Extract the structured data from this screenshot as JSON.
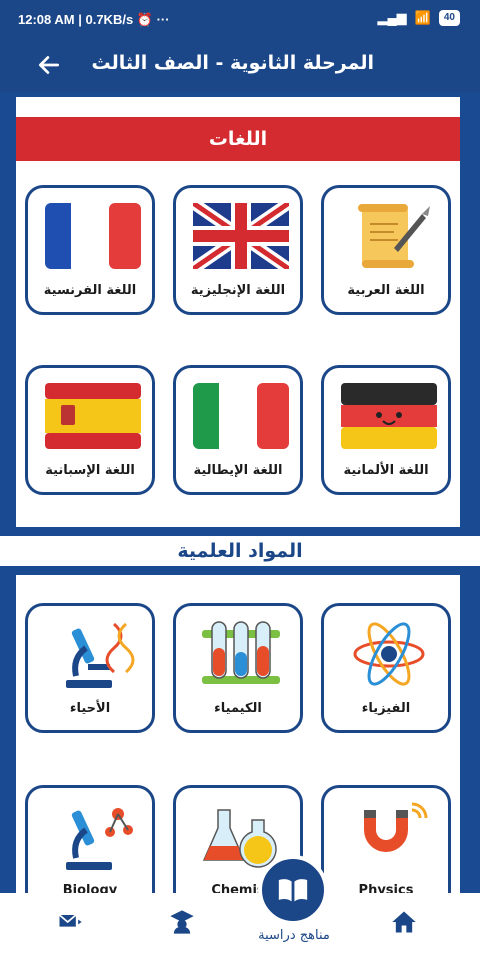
{
  "status_bar": {
    "time": "12:08 AM",
    "speed": "0.7KB/s",
    "battery": "40"
  },
  "header": {
    "title": "المرحلة الثانوية - الصف الثالث"
  },
  "languages": {
    "section_title": "اللغات",
    "tiles": [
      {
        "label": "اللغة العربية",
        "icon": "scroll-quill-icon"
      },
      {
        "label": "اللغة الإنجليزية",
        "icon": "uk-flag-icon"
      },
      {
        "label": "اللغة الفرنسية",
        "icon": "france-flag-icon"
      },
      {
        "label": "اللغة الألمانية",
        "icon": "germany-flag-icon"
      },
      {
        "label": "اللغة الإيطالية",
        "icon": "italy-flag-icon"
      },
      {
        "label": "اللغة الإسبانية",
        "icon": "spain-flag-icon"
      }
    ]
  },
  "sciences": {
    "section_title": "المواد العلمية",
    "tiles": [
      {
        "label": "الفيزياء",
        "icon": "atom-icon"
      },
      {
        "label": "الكيمياء",
        "icon": "test-tubes-icon"
      },
      {
        "label": "الأحياء",
        "icon": "microscope-dna-icon"
      },
      {
        "label": "Physics",
        "icon": "magnet-icon"
      },
      {
        "label": "Chemis",
        "icon": "flasks-icon"
      },
      {
        "label": "Biology",
        "icon": "microscope-molecule-icon"
      }
    ]
  },
  "bottom_nav": {
    "center_label": "مناهج دراسية"
  },
  "colors": {
    "primary": "#1b4789",
    "accent": "#d32b2f"
  }
}
